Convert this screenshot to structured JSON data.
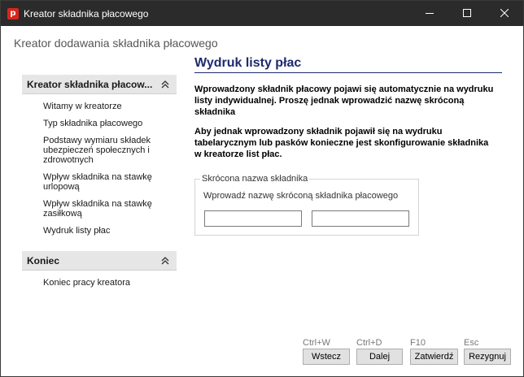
{
  "window": {
    "title": "Kreator składnika płacowego",
    "app_icon_letter": "p"
  },
  "header": {
    "title": "Kreator dodawania składnika płacowego"
  },
  "sidebar": {
    "panels": [
      {
        "title": "Kreator składnika płacow...",
        "items": [
          {
            "label": "Witamy w kreatorze"
          },
          {
            "label": "Typ składnika płacowego"
          },
          {
            "label": "Podstawy wymiaru składek ubezpieczeń społecznych i zdrowotnych"
          },
          {
            "label": "Wpływ składnika na stawkę urlopową"
          },
          {
            "label": "Wpływ składnika na stawkę zasiłkową"
          },
          {
            "label": "Wydruk listy płac"
          }
        ]
      },
      {
        "title": "Koniec",
        "items": [
          {
            "label": "Koniec pracy kreatora"
          }
        ]
      }
    ]
  },
  "content": {
    "title": "Wydruk listy płac",
    "paragraph1": "Wprowadzony składnik płacowy pojawi się automatycznie na wydruku listy indywidualnej. Proszę jednak wprowadzić nazwę skróconą składnika",
    "paragraph2": "Aby jednak wprowadzony składnik pojawił się na wydruku tabelarycznym lub pasków konieczne jest skonfigurowanie składnika w kreatorze list płac.",
    "group": {
      "legend": "Skrócona nazwa składnika",
      "description": "Wprowadź nazwę skróconą składnika płacowego",
      "input1_value": "",
      "input2_value": ""
    }
  },
  "footer": {
    "buttons": [
      {
        "shortcut": "Ctrl+W",
        "label": "Wstecz"
      },
      {
        "shortcut": "Ctrl+D",
        "label": "Dalej"
      },
      {
        "shortcut": "F10",
        "label": "Zatwierdź"
      },
      {
        "shortcut": "Esc",
        "label": "Rezygnuj"
      }
    ]
  }
}
